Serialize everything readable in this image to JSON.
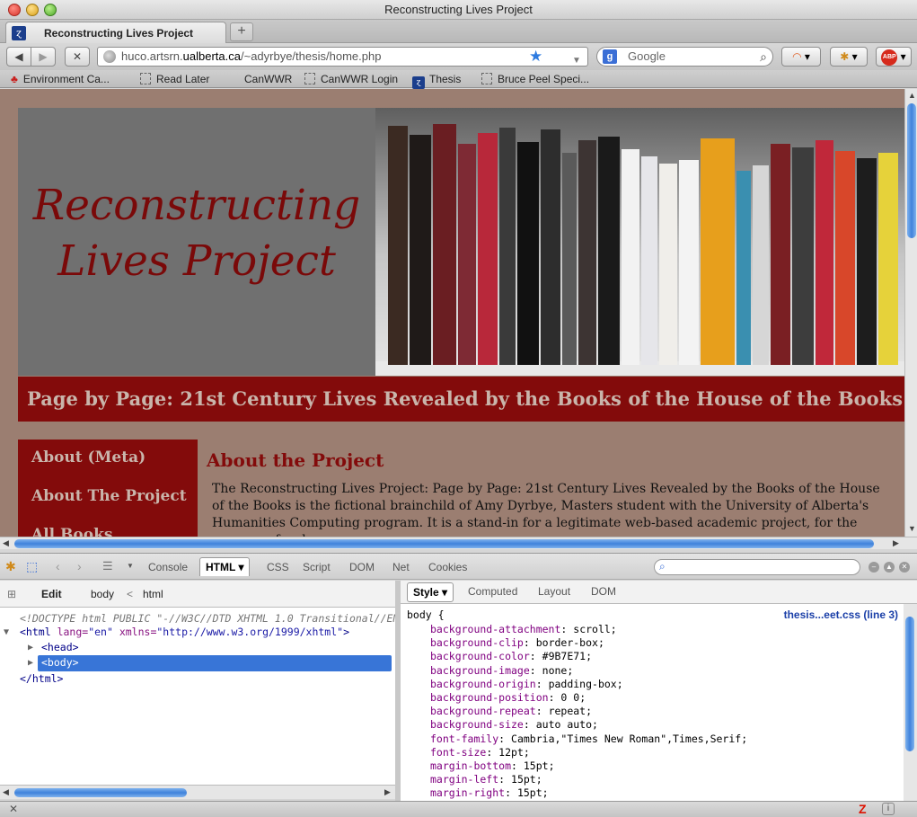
{
  "window": {
    "title": "Reconstructing Lives Project"
  },
  "tabs": [
    {
      "label": "Reconstructing Lives Project"
    }
  ],
  "new_tab": "+",
  "nav": {
    "url_prefix": "huco.artsrn.",
    "url_domain": "ualberta.ca",
    "url_path": "/~adyrbye/thesis/home.php",
    "search_placeholder": "Google",
    "search_engine_letter": "g"
  },
  "bookmarks": [
    {
      "label": "Environment Ca..."
    },
    {
      "label": "Read Later"
    },
    {
      "label": "CanWWR"
    },
    {
      "label": "CanWWR Login"
    },
    {
      "label": "Thesis"
    },
    {
      "label": "Bruce Peel Speci..."
    }
  ],
  "page": {
    "site_title_line1": "Reconstructing",
    "site_title_line2": "Lives Project",
    "subtitle": "Page by Page: 21st Century Lives Revealed by the Books of the House of the Books",
    "nav_items": [
      "About (Meta)",
      "About The Project",
      "All Books"
    ],
    "heading": "About the Project",
    "body_text": "The Reconstructing Lives Project: Page by Page: 21st Century Lives Revealed by the Books of the House of the Books is the fictional brainchild of Amy Dyrbye, Masters student with the University of Alberta's Humanities Computing program. It is a stand-in for a legitimate web-based academic project, for the purpose of web page"
  },
  "firebug": {
    "tabs": [
      "Console",
      "HTML",
      "CSS",
      "Script",
      "DOM",
      "Net",
      "Cookies"
    ],
    "active_tab": "HTML",
    "left_head": {
      "edit": "Edit",
      "crumb1": "body",
      "crumb_sep": "<",
      "crumb2": "html"
    },
    "right_tabs": [
      "Style",
      "Computed",
      "Layout",
      "DOM"
    ],
    "active_right_tab": "Style",
    "html_tree": {
      "doctype": "<!DOCTYPE html PUBLIC \"-//W3C//DTD XHTML 1.0 Transitional//EN\"",
      "html_open_tag": "<html",
      "html_lang_attr": "lang=",
      "html_lang_val": "\"en\"",
      "html_xmlns_attr": "xmlns=",
      "html_xmlns_val": "\"http://www.w3.org/1999/xhtml\"",
      "html_open_close": ">",
      "head": "<head>",
      "body": "<body>",
      "html_close": "</html>"
    },
    "css": {
      "selector": "body {",
      "source": "thesis...eet.css (line 3)",
      "rules": [
        {
          "name": "background-attachment",
          "value": "scroll;"
        },
        {
          "name": "background-clip",
          "value": "border-box;"
        },
        {
          "name": "background-color",
          "value": "#9B7E71;"
        },
        {
          "name": "background-image",
          "value": "none;"
        },
        {
          "name": "background-origin",
          "value": "padding-box;"
        },
        {
          "name": "background-position",
          "value": "0 0;"
        },
        {
          "name": "background-repeat",
          "value": "repeat;"
        },
        {
          "name": "background-size",
          "value": "auto auto;"
        },
        {
          "name": "font-family",
          "value": "Cambria,\"Times New Roman\",Times,Serif;"
        },
        {
          "name": "font-size",
          "value": "12pt;"
        },
        {
          "name": "margin-bottom",
          "value": "15pt;"
        },
        {
          "name": "margin-left",
          "value": "15pt;"
        },
        {
          "name": "margin-right",
          "value": "15pt;"
        }
      ]
    }
  },
  "colors": {
    "page_bg": "#9B7E71",
    "brand_red": "#830B0B",
    "accent_blue": "#3875D7"
  }
}
